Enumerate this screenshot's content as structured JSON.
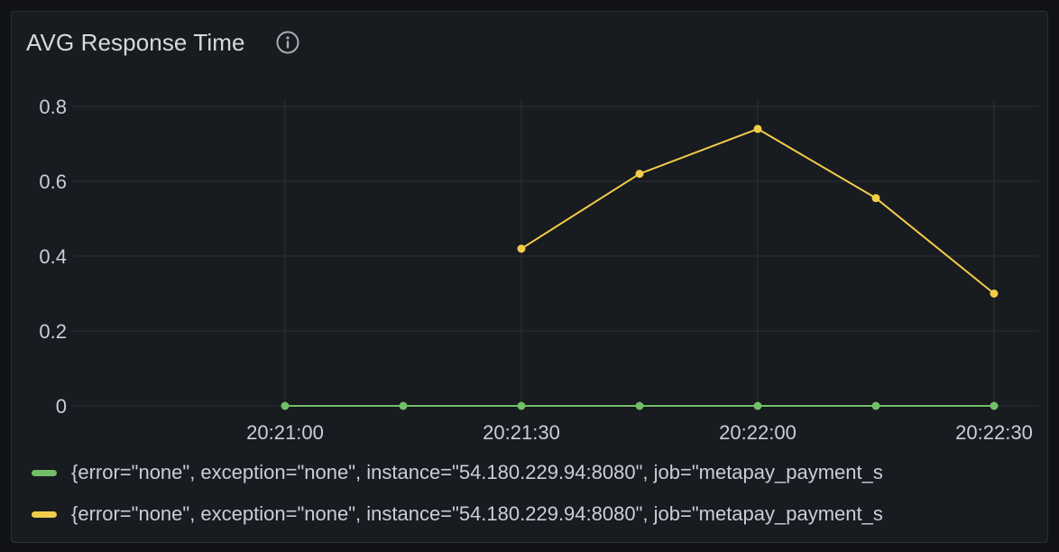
{
  "panel": {
    "title": "AVG Response Time"
  },
  "icons": {
    "info": "info-circle-icon"
  },
  "colors": {
    "background": "#111217",
    "panel_bg": "#181b1f",
    "grid": "#2c2f35",
    "text": "#ccccdc",
    "green_series": "#73bf69",
    "yellow_series": "#f2cc4a"
  },
  "chart_data": {
    "type": "line",
    "title": "AVG Response Time",
    "xlabel": "",
    "ylabel": "",
    "ylim": [
      0,
      0.8
    ],
    "yticks": [
      "0",
      "0.2",
      "0.4",
      "0.6",
      "0.8"
    ],
    "yticks_values": [
      0,
      0.2,
      0.4,
      0.6,
      0.8
    ],
    "xlim": [
      "20:20:30",
      "20:22:30"
    ],
    "xticks": [
      "20:21:00",
      "20:21:30",
      "20:22:00",
      "20:22:30"
    ],
    "grid": true,
    "legend_position": "bottom",
    "series": [
      {
        "name": "{error=\"none\", exception=\"none\", instance=\"54.180.229.94:8080\", job=\"metapay_payment_s",
        "color": "#73bf69",
        "points": [
          {
            "x": "20:21:00",
            "y": 0
          },
          {
            "x": "20:21:15",
            "y": 0
          },
          {
            "x": "20:21:30",
            "y": 0
          },
          {
            "x": "20:21:45",
            "y": 0
          },
          {
            "x": "20:22:00",
            "y": 0
          },
          {
            "x": "20:22:15",
            "y": 0
          },
          {
            "x": "20:22:30",
            "y": 0
          }
        ]
      },
      {
        "name": "{error=\"none\", exception=\"none\", instance=\"54.180.229.94:8080\", job=\"metapay_payment_s",
        "color": "#f2cc4a",
        "points": [
          {
            "x": "20:21:30",
            "y": 0.42
          },
          {
            "x": "20:21:45",
            "y": 0.62
          },
          {
            "x": "20:22:00",
            "y": 0.74
          },
          {
            "x": "20:22:15",
            "y": 0.555
          },
          {
            "x": "20:22:30",
            "y": 0.3
          }
        ]
      }
    ]
  }
}
